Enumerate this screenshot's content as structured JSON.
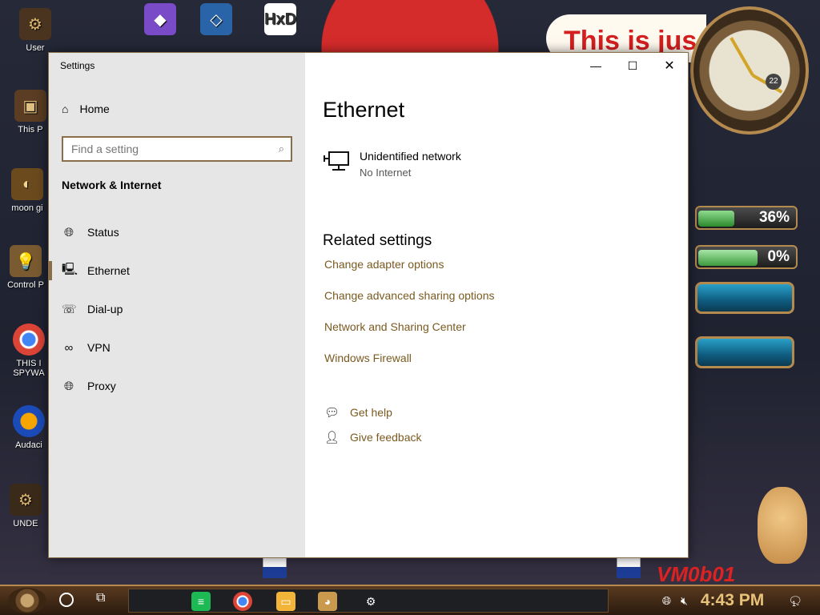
{
  "window": {
    "title": "Settings",
    "minimize": "—",
    "maximize": "☐",
    "close": "✕"
  },
  "sidebar": {
    "home_label": "Home",
    "search_placeholder": "Find a setting",
    "section_label": "Network & Internet",
    "items": [
      {
        "label": "Status",
        "icon": "globe-icon"
      },
      {
        "label": "Ethernet",
        "icon": "ethernet-icon"
      },
      {
        "label": "Dial-up",
        "icon": "dialup-icon"
      },
      {
        "label": "VPN",
        "icon": "vpn-icon"
      },
      {
        "label": "Proxy",
        "icon": "globe-icon"
      }
    ],
    "active_item": "Ethernet"
  },
  "content": {
    "title": "Ethernet",
    "network_name": "Unidentified network",
    "network_status": "No Internet",
    "related_title": "Related settings",
    "links": [
      "Change adapter options",
      "Change advanced sharing options",
      "Network and Sharing Center",
      "Windows Firewall"
    ],
    "get_help": "Get help",
    "give_feedback": "Give feedback"
  },
  "desktop": {
    "icons": [
      "User",
      "This P",
      "moon gi",
      "Control P",
      "THIS I SPYWA",
      "Audaci",
      "UNDE"
    ],
    "banner_text": "This is jus",
    "clock_day": "22",
    "gauge_1": "36%",
    "gauge_2": "0%",
    "vm_text": "VM0b01"
  },
  "taskbar": {
    "time": "4:43 PM",
    "notification_count": "1"
  },
  "colors": {
    "accent": "#8a6e4a",
    "link": "#7a5a20",
    "sidebar_bg": "#e6e6e6"
  }
}
